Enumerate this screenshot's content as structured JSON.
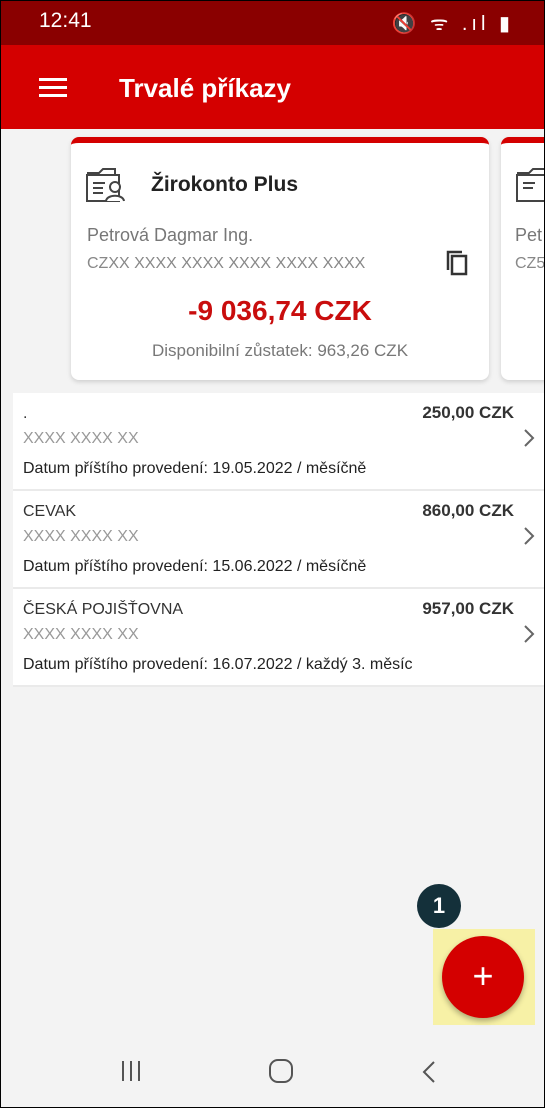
{
  "status_bar": {
    "time": "12:41",
    "icons": "🔇 ᯤ .ıl ▮"
  },
  "app_bar": {
    "title": "Trvalé příkazy"
  },
  "account_card": {
    "name": "Žirokonto Plus",
    "owner": "Petrová Dagmar Ing.",
    "iban": "CZXX XXXX XXXX XXXX XXXX XXXX",
    "balance": "-9 036,74 CZK",
    "available": "Disponibilní zůstatek: 963,26 CZK"
  },
  "account_card_peek": {
    "owner": "Pet",
    "iban": "CZ5"
  },
  "standing_orders": [
    {
      "name": ".",
      "amount": "250,00 CZK",
      "account": "XXXX XXXX XX",
      "next": "Datum příštího provedení: 19.05.2022 / měsíčně"
    },
    {
      "name": "CEVAK",
      "amount": "860,00 CZK",
      "account": "XXXX XXXX XX",
      "next": "Datum příštího provedení: 15.06.2022 / měsíčně"
    },
    {
      "name": "ČESKÁ POJIŠŤOVNA",
      "amount": "957,00 CZK",
      "account": "XXXX XXXX XX",
      "next": "Datum příštího provedení: 16.07.2022 / každý 3. měsíc"
    }
  ],
  "fab": {
    "label": "+"
  },
  "step_badge": "1",
  "colors": {
    "brand": "#d40000",
    "status_bar": "#8a0000",
    "balance": "#c90d0d",
    "badge": "#14303a",
    "highlight": "#f7f1a6"
  }
}
